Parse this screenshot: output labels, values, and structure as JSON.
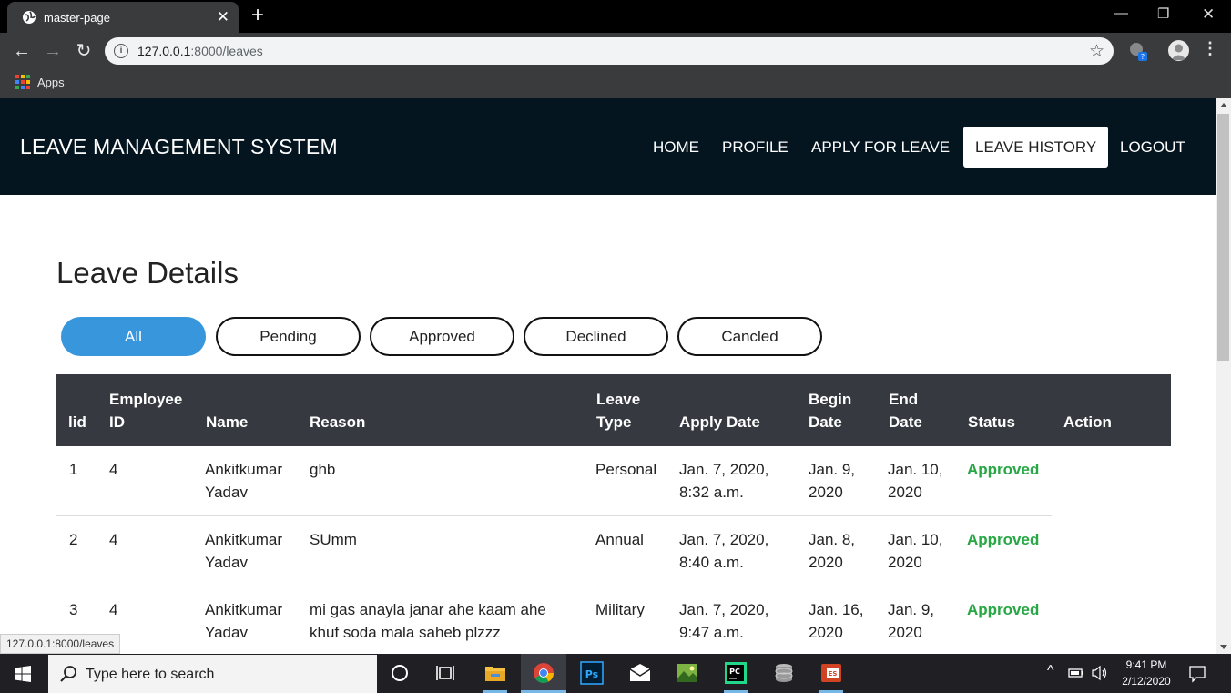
{
  "browser": {
    "tab_title": "master-page",
    "url_host": "127.0.0.1",
    "url_path": ":8000/leaves",
    "bookmarks_apps": "Apps",
    "status_url": "127.0.0.1:8000/leaves"
  },
  "site": {
    "brand": "LEAVE MANAGEMENT SYSTEM",
    "nav": [
      "HOME",
      "PROFILE",
      "APPLY FOR LEAVE",
      "LEAVE HISTORY",
      "LOGOUT"
    ],
    "active_nav": "LEAVE HISTORY"
  },
  "page": {
    "title": "Leave Details",
    "filters": [
      "All",
      "Pending",
      "Approved",
      "Declined",
      "Cancled"
    ],
    "active_filter": "All"
  },
  "table": {
    "headers": {
      "lid": "lid",
      "employee_id": [
        "Employee",
        "ID"
      ],
      "name": "Name",
      "reason": "Reason",
      "leave_type": [
        "Leave",
        "Type"
      ],
      "apply_date": "Apply Date",
      "begin_date": [
        "Begin",
        "Date"
      ],
      "end_date": [
        "End",
        "Date"
      ],
      "status": "Status",
      "action": "Action"
    },
    "rows": [
      {
        "lid": "1",
        "employee_id": "4",
        "name": [
          "Ankitkumar",
          "Yadav"
        ],
        "reason": [
          "ghb",
          ""
        ],
        "leave_type": "Personal",
        "apply_date": [
          "Jan. 7, 2020,",
          "8:32 a.m."
        ],
        "begin_date": [
          "Jan. 9,",
          "2020"
        ],
        "end_date": [
          "Jan. 10,",
          "2020"
        ],
        "status": "Approved"
      },
      {
        "lid": "2",
        "employee_id": "4",
        "name": [
          "Ankitkumar",
          "Yadav"
        ],
        "reason": [
          "SUmm",
          ""
        ],
        "leave_type": "Annual",
        "apply_date": [
          "Jan. 7, 2020,",
          "8:40 a.m."
        ],
        "begin_date": [
          "Jan. 8,",
          "2020"
        ],
        "end_date": [
          "Jan. 10,",
          "2020"
        ],
        "status": "Approved"
      },
      {
        "lid": "3",
        "employee_id": "4",
        "name": [
          "Ankitkumar",
          "Yadav"
        ],
        "reason": [
          "mi gas anayla janar ahe kaam ahe",
          "khuf soda mala saheb plzzz"
        ],
        "leave_type": "Military",
        "apply_date": [
          "Jan. 7, 2020,",
          "9:47 a.m."
        ],
        "begin_date": [
          "Jan. 16,",
          "2020"
        ],
        "end_date": [
          "Jan. 9,",
          "2020"
        ],
        "status": "Approved"
      }
    ]
  },
  "taskbar": {
    "search_placeholder": "Type here to search",
    "time": "9:41 PM",
    "date": "2/12/2020"
  },
  "colors": {
    "navbar_bg": "#04151f",
    "active_filter": "#3897dc",
    "table_header_bg": "#363a40",
    "status_approved": "#28a745"
  }
}
